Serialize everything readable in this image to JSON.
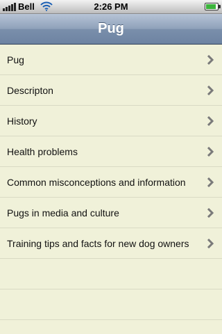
{
  "status_bar": {
    "carrier": "Bell",
    "time": "2:26 PM",
    "battery_level": 0.9
  },
  "nav_bar": {
    "title": "Pug"
  },
  "menu": {
    "items": [
      {
        "label": "Pug"
      },
      {
        "label": "Descripton"
      },
      {
        "label": "History"
      },
      {
        "label": "Health problems"
      },
      {
        "label": "Common misconceptions and information"
      },
      {
        "label": "Pugs in media and culture"
      },
      {
        "label": "Training tips and facts for new dog owners"
      }
    ]
  },
  "colors": {
    "list_background": "#f0f1d9",
    "separator": "#d9dac4",
    "chevron": "#7a7a7a",
    "nav_bar": "#8ea1ba"
  }
}
